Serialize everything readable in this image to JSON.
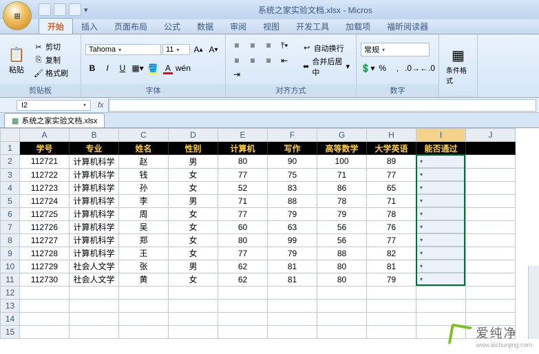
{
  "title": "系统之家实验文档.xlsx - Micros",
  "tabs": [
    "开始",
    "插入",
    "页面布局",
    "公式",
    "数据",
    "审阅",
    "视图",
    "开发工具",
    "加载项",
    "福昕阅读器"
  ],
  "active_tab": 0,
  "clipboard": {
    "label": "剪贴板",
    "paste": "粘贴",
    "cut": "剪切",
    "copy": "复制",
    "fmt": "格式刷"
  },
  "font": {
    "label": "字体",
    "name": "Tahoma",
    "size": "11"
  },
  "align": {
    "label": "对齐方式",
    "wrap": "自动换行",
    "merge": "合并后居中"
  },
  "number": {
    "label": "数字",
    "general": "常规"
  },
  "styles": {
    "cond": "条件格式"
  },
  "name_box": "I2",
  "fx": "fx",
  "wb_tab": "系统之家实验文档.xlsx",
  "columns": [
    "A",
    "B",
    "C",
    "D",
    "E",
    "F",
    "G",
    "H",
    "I",
    "J"
  ],
  "headers": [
    "学号",
    "专业",
    "姓名",
    "性别",
    "计算机",
    "写作",
    "高等数学",
    "大学英语",
    "能否通过"
  ],
  "rows": [
    [
      "112721",
      "计算机科学",
      "赵",
      "男",
      "80",
      "90",
      "100",
      "89",
      ""
    ],
    [
      "112722",
      "计算机科学",
      "钱",
      "女",
      "77",
      "75",
      "71",
      "77",
      ""
    ],
    [
      "112723",
      "计算机科学",
      "孙",
      "女",
      "52",
      "83",
      "86",
      "65",
      ""
    ],
    [
      "112724",
      "计算机科学",
      "李",
      "男",
      "71",
      "88",
      "78",
      "71",
      ""
    ],
    [
      "112725",
      "计算机科学",
      "周",
      "女",
      "77",
      "79",
      "79",
      "78",
      ""
    ],
    [
      "112726",
      "计算机科学",
      "吴",
      "女",
      "60",
      "63",
      "56",
      "76",
      ""
    ],
    [
      "112727",
      "计算机科学",
      "郑",
      "女",
      "80",
      "99",
      "56",
      "77",
      ""
    ],
    [
      "112728",
      "计算机科学",
      "王",
      "女",
      "77",
      "79",
      "88",
      "82",
      ""
    ],
    [
      "112729",
      "社会人文学",
      "张",
      "男",
      "62",
      "81",
      "80",
      "81",
      ""
    ],
    [
      "112730",
      "社会人文学",
      "黄",
      "女",
      "62",
      "81",
      "80",
      "79",
      ""
    ]
  ],
  "selected_col": 8,
  "selected_rows": [
    2,
    11
  ],
  "watermark": {
    "cn": "爱纯净",
    "en": "www.aichunjing.com"
  }
}
